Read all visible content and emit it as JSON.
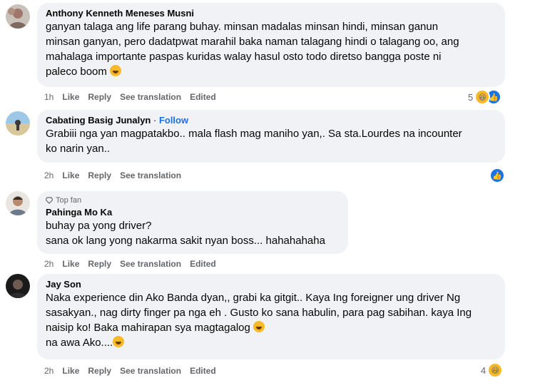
{
  "comments": [
    {
      "author": "Anthony Kenneth Meneses Musni",
      "lines": [
        "ganyan talaga ang life parang buhay. minsan madalas minsan hindi, minsan ganun",
        "minsan ganyan, pero dadatpwat marahil baka naman talagang hindi o talagang oo, ang",
        "mahalaga importante paspas kuridas walay hasul osto todo diretso bangga poste ni",
        "paleco boom"
      ],
      "time": "1h",
      "like": "Like",
      "reply": "Reply",
      "translate": "See translation",
      "edited": "Edited",
      "reaction_count": "5"
    },
    {
      "author": "Cabating Basig Junalyn",
      "follow_sep": " · ",
      "follow": "Follow",
      "lines": [
        "Grabiii nga yan magpatakbo.. mala flash mag maniho yan,. Sa sta.Lourdes na incounter",
        "ko narin yan.."
      ],
      "time": "2h",
      "like": "Like",
      "reply": "Reply",
      "translate": "See translation"
    },
    {
      "badge": "Top fan",
      "author": "Pahinga Mo Ka",
      "lines": [
        "buhay pa yong driver?",
        "sana ok lang yong nakarma sakit nyan boss... hahahahaha"
      ],
      "time": "2h",
      "like": "Like",
      "reply": "Reply",
      "translate": "See translation",
      "edited": "Edited"
    },
    {
      "author": "Jay Son",
      "lines": [
        "Naka experience din Ako Banda dyan,, grabi ka gitgit.. Kaya Ing foreigner ung driver Ng",
        "sasakyan., nag dirty finger pa nga eh . Gusto ko sana habulin, para pag sabihan. kaya Ing",
        "naisip ko! Baka mahirapan sya magtagalog",
        "na awa Ako...."
      ],
      "time": "2h",
      "like": "Like",
      "reply": "Reply",
      "translate": "See translation",
      "edited": "Edited",
      "reaction_count": "4"
    }
  ],
  "colors": {
    "bubble": "#f0f2f5",
    "meta": "#65676b",
    "follow": "#216fdb",
    "like": "#1b74e4",
    "haha": "#f7b928"
  },
  "icons": {
    "reaction_haha": "haha-emoji-icon",
    "reaction_like": "like-thumb-icon",
    "top_fan": "diamond-icon"
  }
}
